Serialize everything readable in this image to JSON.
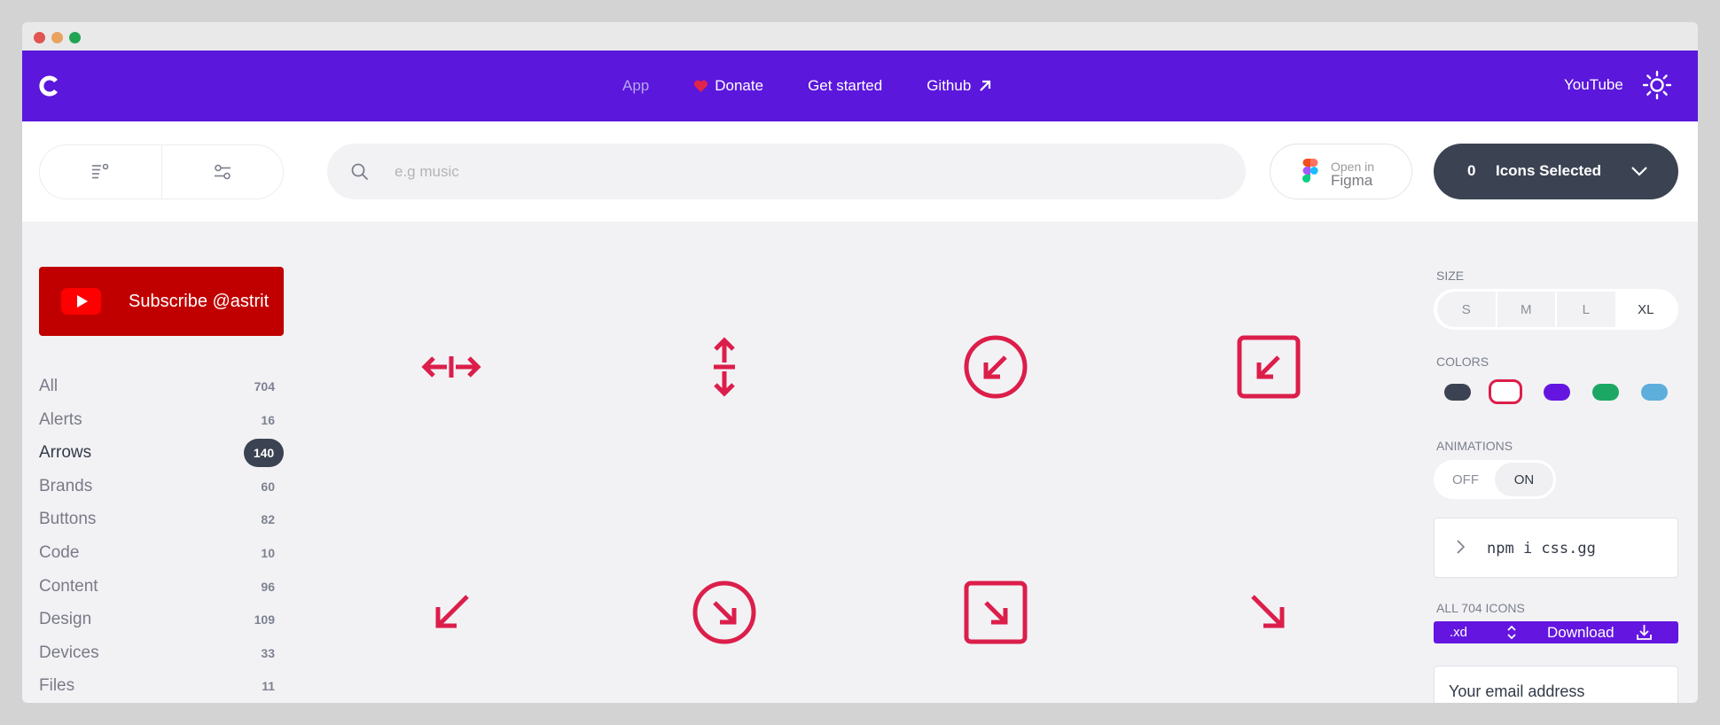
{
  "nav": {
    "app": "App",
    "donate": "Donate",
    "get_started": "Get started",
    "github": "Github",
    "youtube": "YouTube"
  },
  "search": {
    "placeholder": "e.g music"
  },
  "figma": {
    "open": "Open in",
    "name": "Figma"
  },
  "selected": {
    "count": "0",
    "label": "Icons Selected"
  },
  "subscribe": {
    "label": "Subscribe @astrit"
  },
  "categories": [
    {
      "name": "All",
      "count": "704"
    },
    {
      "name": "Alerts",
      "count": "16"
    },
    {
      "name": "Arrows",
      "count": "140",
      "active": true
    },
    {
      "name": "Brands",
      "count": "60"
    },
    {
      "name": "Buttons",
      "count": "82"
    },
    {
      "name": "Code",
      "count": "10"
    },
    {
      "name": "Content",
      "count": "96"
    },
    {
      "name": "Design",
      "count": "109"
    },
    {
      "name": "Devices",
      "count": "33"
    },
    {
      "name": "Files",
      "count": "11"
    }
  ],
  "icons": [
    {
      "name": "arrows-merge-alt-h-icon"
    },
    {
      "name": "arrows-merge-alt-v-icon"
    },
    {
      "name": "arrow-bottom-left-o-icon"
    },
    {
      "name": "arrow-bottom-left-r-icon"
    },
    {
      "name": "arrow-bottom-left-icon"
    },
    {
      "name": "arrow-bottom-right-o-icon"
    },
    {
      "name": "arrow-bottom-right-r-icon"
    },
    {
      "name": "arrow-bottom-right-icon"
    }
  ],
  "panel": {
    "size_label": "SIZE",
    "sizes": [
      "S",
      "M",
      "L",
      "XL"
    ],
    "active_size": "XL",
    "colors_label": "COLORS",
    "colors": [
      "#3b4353",
      "#dc1e4a",
      "#6416e0",
      "#1ca864",
      "#5eaedb"
    ],
    "active_color": "#dc1e4a",
    "animations_label": "ANIMATIONS",
    "anim_off": "OFF",
    "anim_on": "ON",
    "anim_active": "ON",
    "npm_command": "npm i css.gg",
    "all_icons_label": "ALL 704 ICONS",
    "format": ".xd",
    "download_label": "Download",
    "email_placeholder": "Your email address"
  },
  "icon_color": "#dc1e4a",
  "brand_color": "#5b17dc"
}
